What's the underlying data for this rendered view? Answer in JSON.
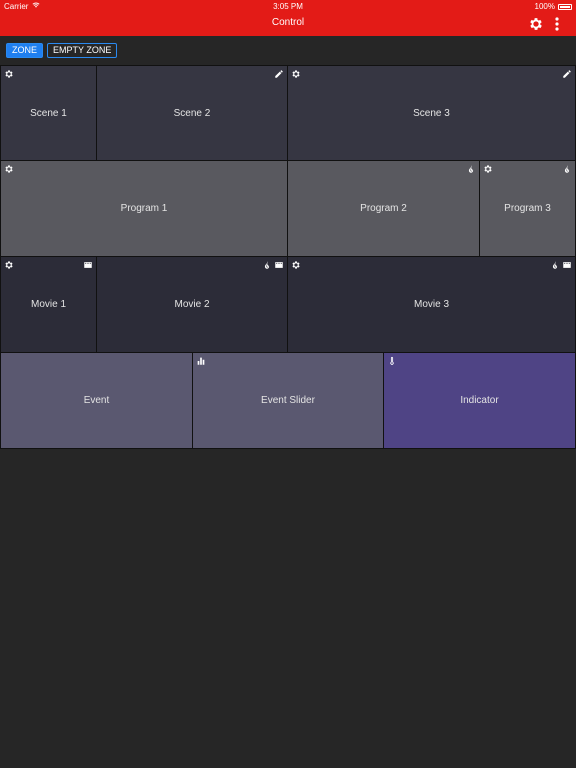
{
  "status_bar": {
    "carrier": "Carrier",
    "time": "3:05 PM",
    "battery": "100%"
  },
  "nav": {
    "title": "Control",
    "settings_icon": "gear-icon",
    "more_icon": "more-vertical-icon"
  },
  "segments": {
    "zone": "ZONE",
    "empty_zone": "EMPTY ZONE"
  },
  "tiles": {
    "scene1": "Scene 1",
    "scene2": "Scene 2",
    "scene3": "Scene 3",
    "program1": "Program 1",
    "program2": "Program 2",
    "program3": "Program 3",
    "movie1": "Movie 1",
    "movie2": "Movie 2",
    "movie3": "Movie 3",
    "event": "Event",
    "event_slider": "Event Slider",
    "indicator": "Indicator"
  },
  "colors": {
    "header": "#e31b17",
    "background": "#262626",
    "accent": "#1f7ff0",
    "indicator": "#4f4485"
  }
}
